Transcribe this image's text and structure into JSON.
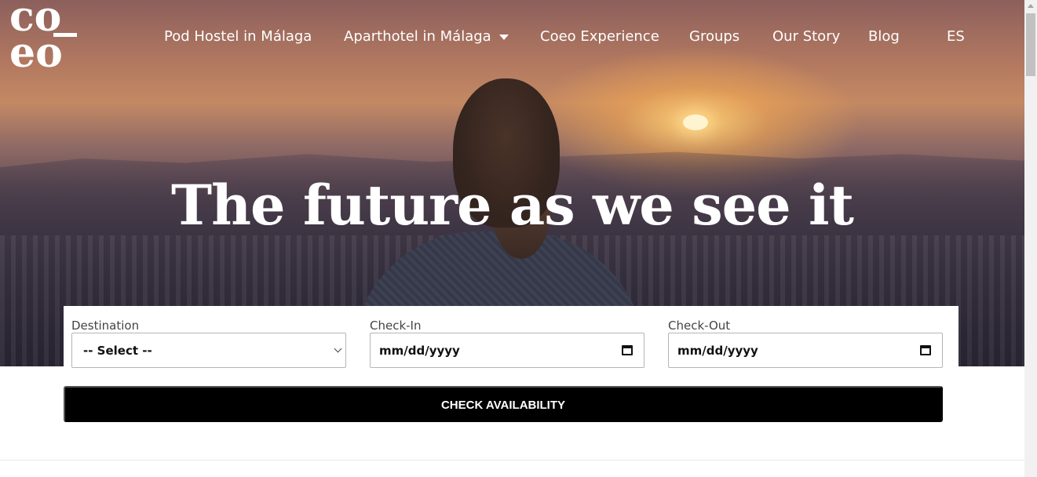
{
  "logo": {
    "line1": "co",
    "line2": "eo"
  },
  "nav": {
    "items": [
      {
        "label": "Pod Hostel in Málaga"
      },
      {
        "label": "Aparthotel in Málaga",
        "has_dropdown": true
      },
      {
        "label": "Coeo Experience"
      },
      {
        "label": "Groups"
      },
      {
        "label": "Our Story"
      },
      {
        "label": "Blog"
      }
    ],
    "language": "ES"
  },
  "hero": {
    "headline": "The future as we see it"
  },
  "booking": {
    "destination": {
      "label": "Destination",
      "value": "-- Select --"
    },
    "checkin": {
      "label": "Check-In",
      "placeholder": "mm/dd/yyyy"
    },
    "checkout": {
      "label": "Check-Out",
      "placeholder": "mm/dd/yyyy"
    },
    "submit_label": "CHECK AVAILABILITY"
  },
  "colors": {
    "button_bg": "#000000",
    "text_on_hero": "#ffffff"
  }
}
